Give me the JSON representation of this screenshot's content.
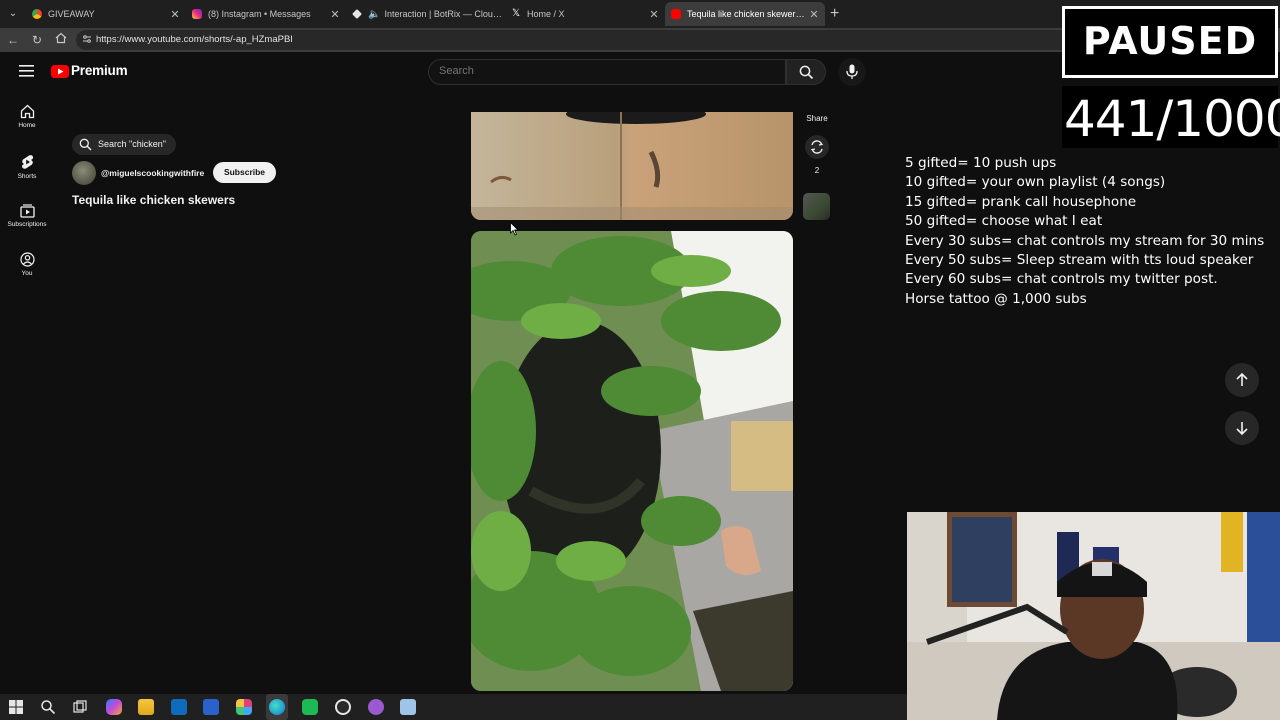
{
  "browser": {
    "tabs": [
      {
        "title": "GIVEAWAY",
        "icon": "chrome-icon",
        "active": false
      },
      {
        "title": "(8) Instagram • Messages",
        "icon": "instagram-icon",
        "active": false
      },
      {
        "title": "Interaction | BotRix — Cloud S",
        "icon": "botrix-icon",
        "active": false
      },
      {
        "title": "Home / X",
        "icon": "x-icon",
        "active": false
      },
      {
        "title": "Tequila like chicken skewers - YouT",
        "icon": "youtube-icon",
        "active": true
      }
    ],
    "url": "https://www.youtube.com/shorts/-ap_HZmaPBI"
  },
  "youtube": {
    "logo_text": "Premium",
    "search_placeholder": "Search",
    "rail": [
      {
        "label": "Home",
        "icon": "home-icon"
      },
      {
        "label": "Shorts",
        "icon": "shorts-icon"
      },
      {
        "label": "Subscriptions",
        "icon": "subscriptions-icon"
      },
      {
        "label": "You",
        "icon": "you-icon"
      }
    ],
    "short": {
      "search_chip": "Search \"chicken\"",
      "channel": "@miguelscookingwithfire",
      "subscribe_label": "Subscribe",
      "title": "Tequila like chicken skewers",
      "share_label": "Share",
      "remix_count": "2"
    }
  },
  "overlay": {
    "paused": "PAUSED",
    "counter": "441/1000",
    "goals": [
      "5 gifted= 10 push ups",
      "10 gifted= your own playlist (4 songs)",
      "15 gifted= prank call housephone",
      "50 gifted= choose what I eat",
      "Every 30 subs= chat controls my stream for 30 mins",
      "Every 50 subs= Sleep stream with tts loud speaker",
      "Every 60 subs= chat controls my twitter post.",
      "Horse tattoo @ 1,000 subs"
    ]
  },
  "colors": {
    "youtube_red": "#ff0000",
    "page_bg": "#0f0f0f",
    "tab_strip": "#1f1f1f"
  }
}
